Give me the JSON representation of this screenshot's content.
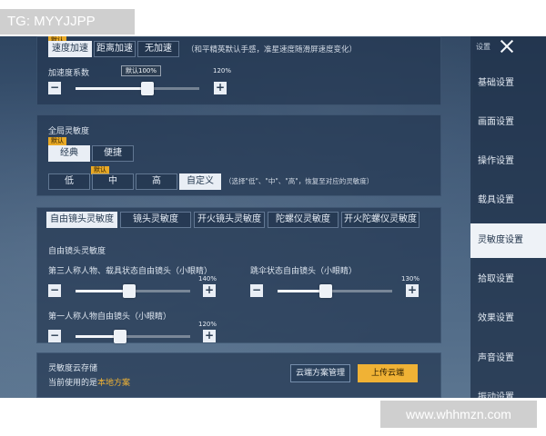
{
  "watermarks": {
    "top_left": "TG: MYYJJPP",
    "bottom_right": "www.whhmzn.com"
  },
  "speed_mode": {
    "default_tag": "默认",
    "options": [
      "速度加速",
      "距离加速",
      "无加速"
    ],
    "selected": "速度加速",
    "note": "（和平精英默认手感，准星速度随滑屏速度变化）"
  },
  "accel_coef": {
    "label": "加速度系数",
    "tooltip": "默认100%",
    "max_label": "120%",
    "value_fraction": 0.58
  },
  "global_sensitivity": {
    "title": "全局灵敏度",
    "style_default_tag": "默认",
    "styles": [
      "经典",
      "便捷"
    ],
    "selected_style": "经典",
    "level_default_tag": "默认",
    "levels": [
      "低",
      "中",
      "高",
      "自定义"
    ],
    "selected_level": "自定义",
    "level_note": "（选择\"低\"、\"中\"、\"高\"，恢复至对应的灵敏度）"
  },
  "sensitivity_tabs": [
    "自由镜头灵敏度",
    "镜头灵敏度",
    "开火镜头灵敏度",
    "陀螺仪灵敏度",
    "开火陀螺仪灵敏度"
  ],
  "selected_tab": "自由镜头灵敏度",
  "free_camera": {
    "section_label": "自由镜头灵敏度",
    "sliders": [
      {
        "label": "第三人称人物、载具状态自由镜头（小眼睛）",
        "max_label": "140%",
        "value_fraction": 0.47
      },
      {
        "label": "跳伞状态自由镜头（小眼睛）",
        "max_label": "130%",
        "value_fraction": 0.42
      },
      {
        "label": "第一人称人物自由镜头（小眼睛）",
        "max_label": "120%",
        "value_fraction": 0.39
      }
    ]
  },
  "cloud": {
    "title": "灵敏度云存储",
    "current_prefix": "当前使用的是",
    "current_value": "本地方案",
    "manage_label": "云端方案管理",
    "upload_label": "上传云端"
  },
  "sidebar": {
    "header": "设置",
    "items": [
      "基础设置",
      "画面设置",
      "操作设置",
      "载具设置",
      "灵敏度设置",
      "拾取设置",
      "效果设置",
      "声音设置",
      "振动设置"
    ],
    "active": "灵敏度设置"
  },
  "colors": {
    "accent_gold": "#f0b235",
    "panel_bg": "#243852",
    "active_light": "#eef2f7"
  }
}
